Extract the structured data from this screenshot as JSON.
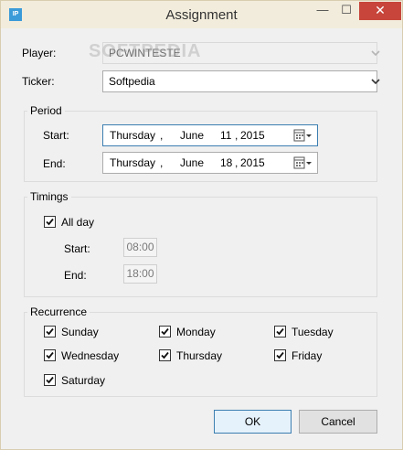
{
  "window": {
    "title": "Assignment",
    "icon_text": "IP",
    "minimize": "—",
    "maximize": "☐",
    "close": "✕"
  },
  "watermark": "SOFTPEDIA",
  "player": {
    "label": "Player:",
    "value": "PCWINTESTE"
  },
  "ticker": {
    "label": "Ticker:",
    "value": "Softpedia"
  },
  "period": {
    "title": "Period",
    "start": {
      "label": "Start:",
      "weekday": "Thursday",
      "sep": ",",
      "month": "June",
      "day": "11",
      "year": "2015"
    },
    "end": {
      "label": "End:",
      "weekday": "Thursday",
      "sep": ",",
      "month": "June",
      "day": "18",
      "year": "2015"
    }
  },
  "timings": {
    "title": "Timings",
    "all_day": {
      "label": "All day",
      "checked": true
    },
    "start": {
      "label": "Start:",
      "value": "08:00"
    },
    "end": {
      "label": "End:",
      "value": "18:00"
    }
  },
  "recurrence": {
    "title": "Recurrence",
    "days": [
      {
        "label": "Sunday",
        "checked": true
      },
      {
        "label": "Monday",
        "checked": true
      },
      {
        "label": "Tuesday",
        "checked": true
      },
      {
        "label": "Wednesday",
        "checked": true
      },
      {
        "label": "Thursday",
        "checked": true
      },
      {
        "label": "Friday",
        "checked": true
      },
      {
        "label": "Saturday",
        "checked": true
      }
    ]
  },
  "buttons": {
    "ok": "OK",
    "cancel": "Cancel"
  },
  "colors": {
    "accent": "#3c7fb1",
    "close": "#c7453a",
    "frame": "#f2ecdc"
  }
}
